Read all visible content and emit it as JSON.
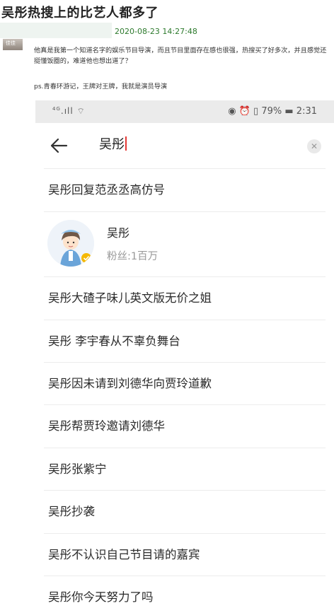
{
  "post": {
    "title": "吴彤热搜上的比艺人都多了",
    "timestamp": "2020-08-23 14:27:48",
    "avatar_tag": "佳佳",
    "body": "他真是我第一个知道名字的娱乐节目导演，而且节目里面存在感也很强，热搜买了好多次，并且感觉还挺懂饭圈的，难道他也想出道了？",
    "ps": "ps.青春环游记，王牌对王牌，我就是演员导演"
  },
  "phone": {
    "status": {
      "network": "4G",
      "battery_text": "79%",
      "time": "2:31"
    },
    "search": {
      "query": "吴彤"
    },
    "suggestions": [
      "吴彤回复范丞丞高仿号",
      "吴彤大碴子味儿英文版无价之姐",
      "吴彤 李宇春从不辜负舞台",
      "吴彤因未请到刘德华向贾玲道歉",
      "吴彤帮贾玲邀请刘德华",
      "吴彤张紫宁",
      "吴彤抄袭",
      "吴彤不认识自己节目请的嘉宾",
      "吴彤你今天努力了吗"
    ],
    "user_card": {
      "name": "吴彤",
      "fans": "粉丝:1百万"
    },
    "colors": {
      "caret": "#e53935",
      "verified_badge": "#f5b800",
      "status_bar_bg": "#ebebeb"
    }
  }
}
